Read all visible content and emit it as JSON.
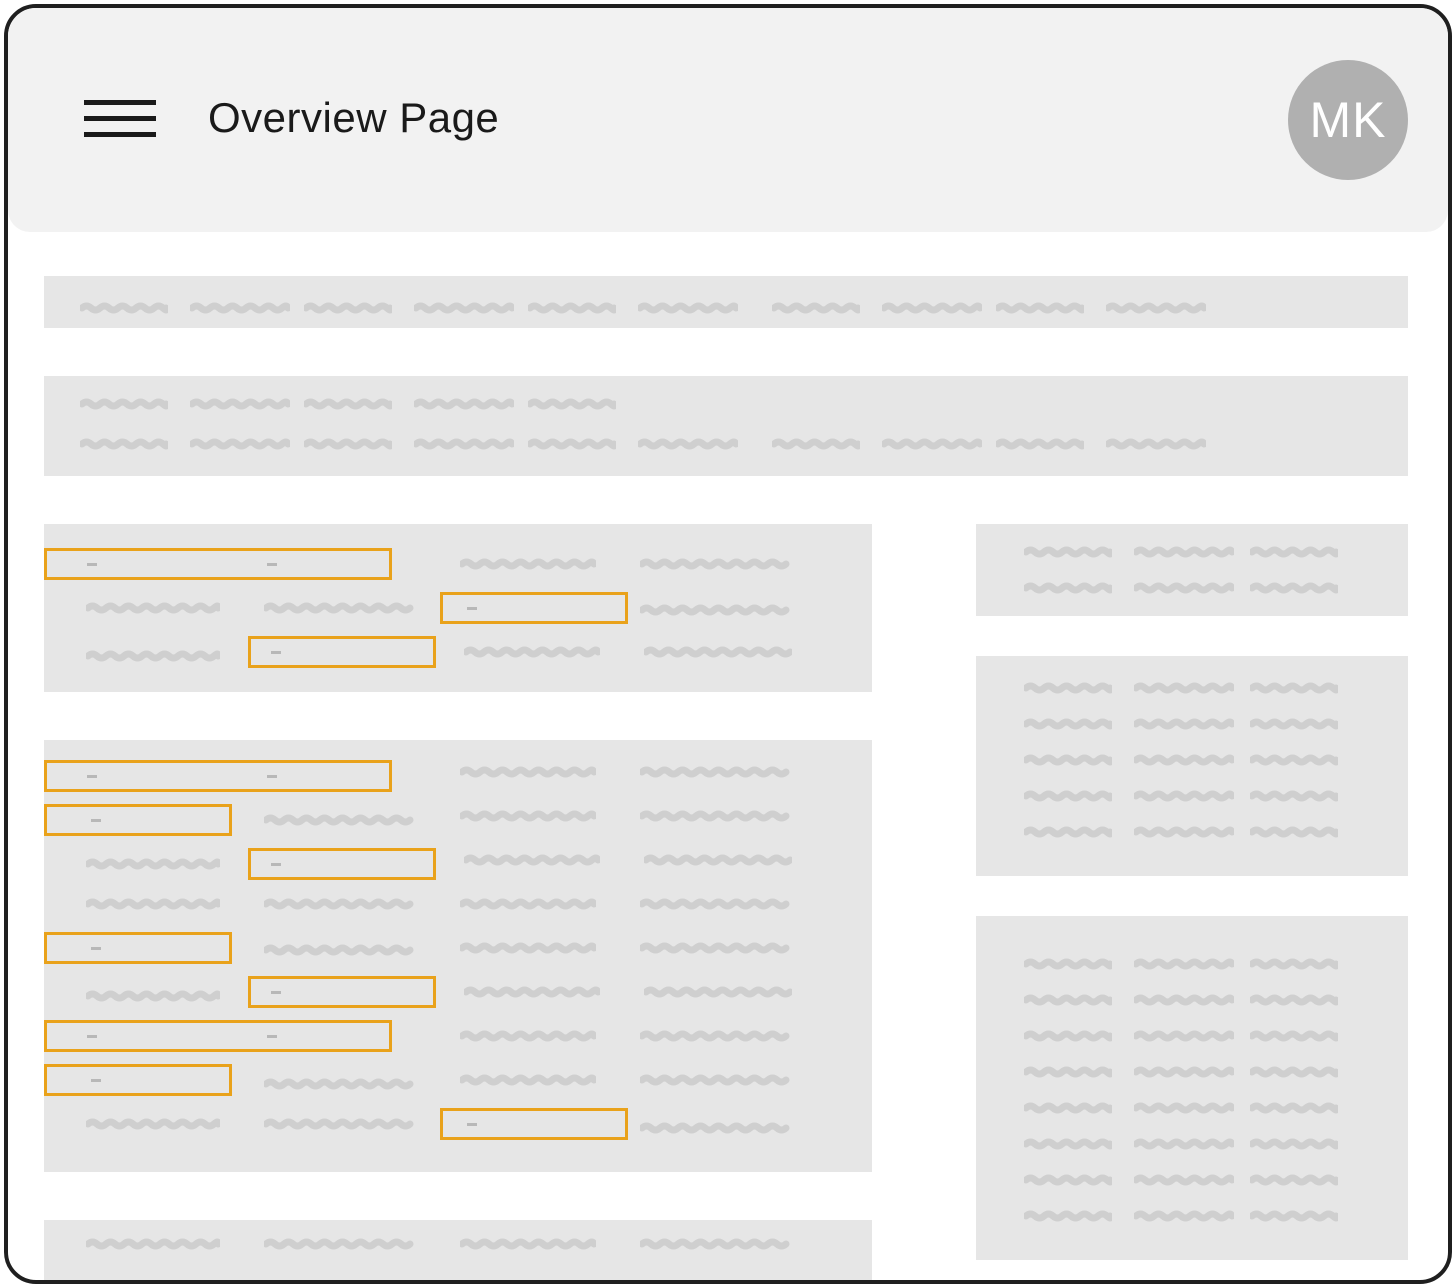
{
  "header": {
    "title": "Overview Page",
    "avatar_initials": "MK"
  },
  "icons": {
    "menu": "hamburger-menu-icon"
  },
  "colors": {
    "frame_border": "#1f1f1f",
    "header_bg": "#f2f2f2",
    "panel_bg": "#e6e6e6",
    "placeholder_text": "#cfcfcf",
    "input_highlight": "#e9a21b",
    "avatar_bg": "#b0b0b0"
  }
}
